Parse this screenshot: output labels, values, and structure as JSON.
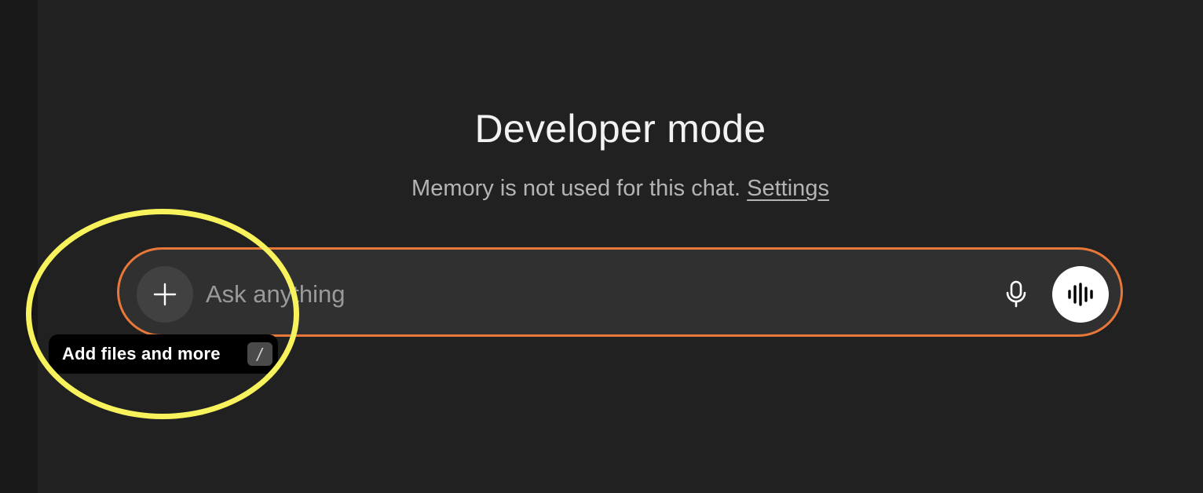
{
  "header": {
    "title": "Developer mode",
    "subtitle_text": "Memory is not used for this chat.",
    "settings_link": "Settings"
  },
  "composer": {
    "placeholder": "Ask anything",
    "value": "",
    "add_button_icon": "plus-icon",
    "mic_icon": "microphone-icon",
    "voice_icon": "voice-waveform-icon",
    "border_color": "#e8773a"
  },
  "tooltip": {
    "label": "Add files and more",
    "shortcut": "/"
  },
  "annotation": {
    "ring_color": "#f8f35c"
  }
}
